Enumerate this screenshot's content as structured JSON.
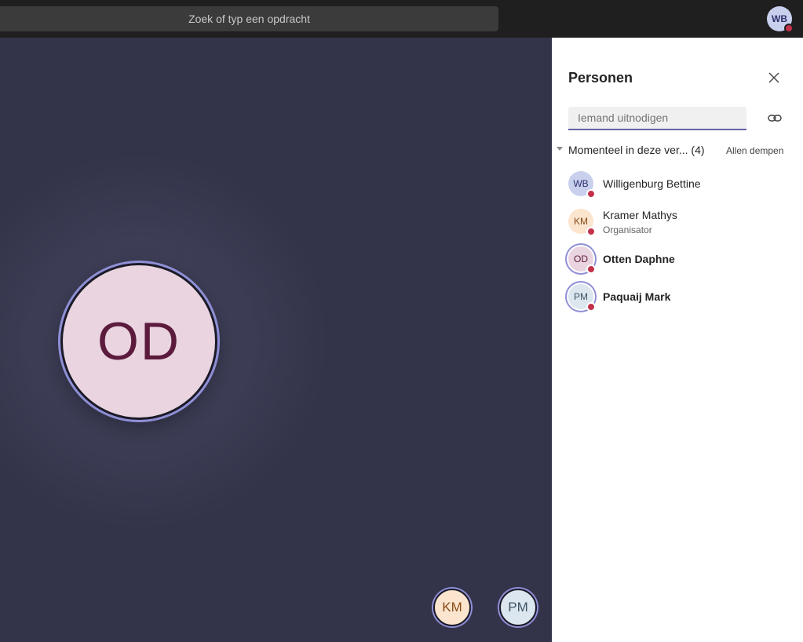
{
  "topbar": {
    "search_placeholder": "Zoek of typ een opdracht",
    "me_initials": "WB",
    "me_status_color": "#c4314b"
  },
  "stage": {
    "speaker": {
      "initials": "OD",
      "bg": "#e9d4e0",
      "fg": "#5c1b3c"
    },
    "thumbnails": [
      {
        "initials": "KM"
      },
      {
        "initials": "PM"
      }
    ]
  },
  "panel": {
    "title": "Personen",
    "invite_placeholder": "Iemand uitnodigen",
    "section_label": "Momenteel in deze ver... (4)",
    "mute_all_label": "Allen dempen",
    "participants": [
      {
        "initials": "WB",
        "name": "Willigenburg Bettine",
        "role": ""
      },
      {
        "initials": "KM",
        "name": "Kramer Mathys",
        "role": "Organisator"
      },
      {
        "initials": "OD",
        "name": "Otten Daphne",
        "role": ""
      },
      {
        "initials": "PM",
        "name": "Paquaij Mark",
        "role": ""
      }
    ]
  },
  "colors": {
    "accent": "#6264a7",
    "ring": "#8f8fd6",
    "status_busy": "#c4314b"
  },
  "icons": {
    "close": "close-icon",
    "link": "link-icon",
    "caret": "chevron-down-icon"
  }
}
